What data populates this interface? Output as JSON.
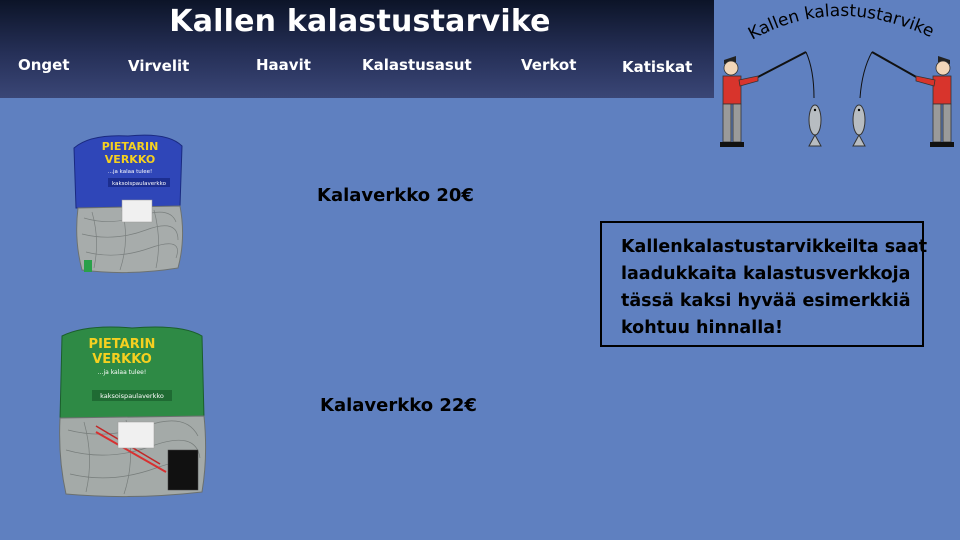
{
  "header": {
    "title": "Kallen kalastustarvike",
    "nav": [
      "Onget",
      "Virvelit",
      "Haavit",
      "Kalastusasut",
      "Verkot",
      "Katiskat"
    ]
  },
  "logo": {
    "arc_text": "Kallen kalastustarvike"
  },
  "products": [
    {
      "label": "Kalaverkko 20€",
      "package": {
        "brand_line1": "PIETARIN",
        "brand_line2": "VERKKO",
        "tagline": "...ja kalaa tulee!",
        "type": "kaksoispaulaverkko",
        "color": "#2f46b8"
      }
    },
    {
      "label": "Kalaverkko 22€",
      "package": {
        "brand_line1": "PIETARIN",
        "brand_line2": "VERKKO",
        "tagline": "...ja kalaa tulee!",
        "type": "kaksoispaulaverkko",
        "color": "#2e8a45"
      }
    }
  ],
  "info": {
    "lines": [
      "Kallenkalastustarvikkeilta saat",
      "laadukkaita kalastusverkkoja",
      "tässä kaksi hyvää esimerkkiä",
      "kohtuu hinnalla!"
    ]
  },
  "colors": {
    "background": "#5f80c0",
    "header_dark": "#0c1428",
    "header_light": "#3a4676",
    "shirt": "#d8342c",
    "pants": "#9a9a9a"
  }
}
